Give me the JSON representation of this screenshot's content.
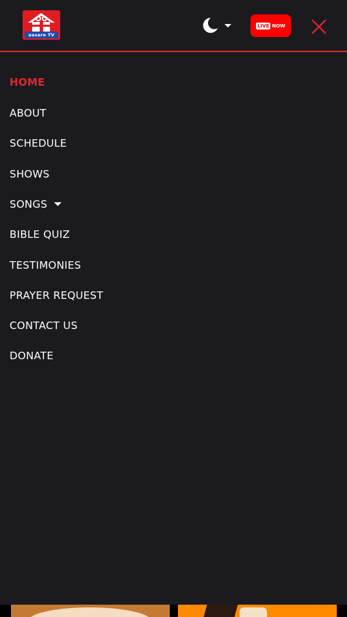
{
  "header": {
    "logo_text": "aasare TV",
    "live_badge": "LIVE",
    "live_now": "NOW",
    "accent_color": "#e0262d",
    "icons": [
      "moon-icon",
      "chevron-down-icon",
      "close-icon"
    ]
  },
  "menu": {
    "items": [
      {
        "label": "HOME",
        "active": true
      },
      {
        "label": "ABOUT",
        "active": false
      },
      {
        "label": "SCHEDULE",
        "active": false
      },
      {
        "label": "SHOWS",
        "active": false
      },
      {
        "label": "SONGS",
        "active": false,
        "has_submenu": true
      },
      {
        "label": "BIBLE QUIZ",
        "active": false
      },
      {
        "label": "TESTIMONIES",
        "active": false
      },
      {
        "label": "PRAYER REQUEST",
        "active": false
      },
      {
        "label": "CONTACT US",
        "active": false
      },
      {
        "label": "DONATE",
        "active": false
      }
    ]
  }
}
